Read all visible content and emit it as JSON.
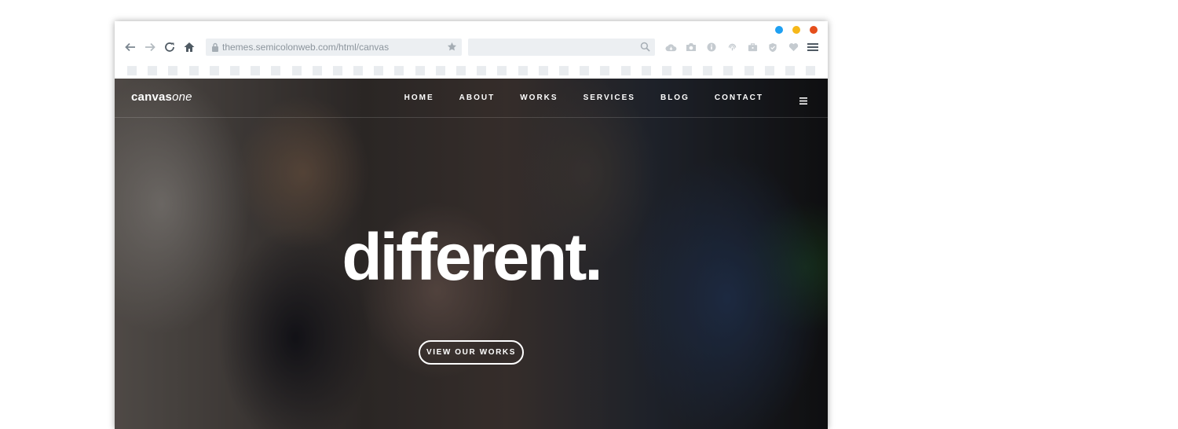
{
  "window": {
    "dot_colors": [
      "#1ea0f2",
      "#f6b819",
      "#e54e1b"
    ]
  },
  "toolbar": {
    "back_icon": "back-arrow-icon",
    "forward_icon": "forward-arrow-icon",
    "reload_icon": "reload-icon",
    "home_icon": "home-icon",
    "url": "themes.semicolonweb.com/html/canvas",
    "search_placeholder": "",
    "extension_icons": [
      "cloud-icon",
      "camera-icon",
      "info-icon",
      "fingerprint-icon",
      "briefcase-icon",
      "shield-icon",
      "heart-icon"
    ],
    "menu_icon": "hamburger-icon"
  },
  "site": {
    "logo_a": "canvas",
    "logo_b": "one",
    "nav": [
      "HOME",
      "ABOUT",
      "WORKS",
      "SERVICES",
      "BLOG",
      "CONTACT"
    ],
    "hero_title": "different.",
    "hero_button": "VIEW OUR WORKS"
  }
}
